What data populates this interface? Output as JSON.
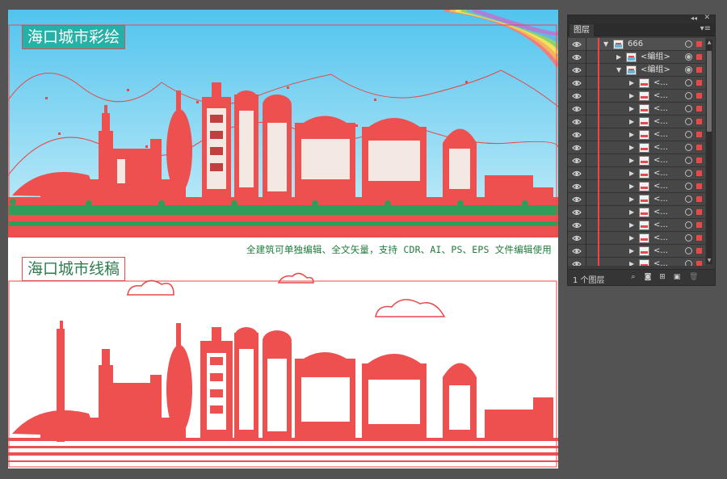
{
  "artboard": {
    "title_color": "海口城市彩绘",
    "title_line": "海口城市线稿",
    "tagline": "全建筑可单独编辑、全文矢量，支持 CDR、AI、PS、EPS 文件编辑使用"
  },
  "colors": {
    "accent_red": "#e84848",
    "sky_top": "#52c4ee",
    "sky_bottom": "#c9eef9",
    "teal_title": "#26b1a8",
    "green_ground": "#2e9e5a",
    "panel_bg": "#3c3c3c",
    "workspace": "#535353"
  },
  "layers_panel": {
    "tab_label": "图层",
    "footer_count": "1 个图层",
    "rows": [
      {
        "label": "666",
        "level": 0,
        "expanded": true,
        "thumb": "group",
        "targeted": false
      },
      {
        "label": "<编组>",
        "level": 1,
        "expanded": false,
        "thumb": "group",
        "targeted": true
      },
      {
        "label": "<编组>",
        "level": 1,
        "expanded": true,
        "thumb": "group",
        "targeted": true
      },
      {
        "label": "<...",
        "level": 2,
        "expanded": false,
        "thumb": "item",
        "targeted": false
      },
      {
        "label": "<...",
        "level": 2,
        "expanded": false,
        "thumb": "item",
        "targeted": false
      },
      {
        "label": "<...",
        "level": 2,
        "expanded": false,
        "thumb": "item",
        "targeted": false
      },
      {
        "label": "<...",
        "level": 2,
        "expanded": false,
        "thumb": "item",
        "targeted": false
      },
      {
        "label": "<...",
        "level": 2,
        "expanded": false,
        "thumb": "item",
        "targeted": false
      },
      {
        "label": "<...",
        "level": 2,
        "expanded": false,
        "thumb": "item",
        "targeted": false
      },
      {
        "label": "<...",
        "level": 2,
        "expanded": false,
        "thumb": "item",
        "targeted": false
      },
      {
        "label": "<...",
        "level": 2,
        "expanded": false,
        "thumb": "item",
        "targeted": false
      },
      {
        "label": "<...",
        "level": 2,
        "expanded": false,
        "thumb": "item",
        "targeted": false
      },
      {
        "label": "<...",
        "level": 2,
        "expanded": false,
        "thumb": "item",
        "targeted": false
      },
      {
        "label": "<...",
        "level": 2,
        "expanded": false,
        "thumb": "item",
        "targeted": false
      },
      {
        "label": "<...",
        "level": 2,
        "expanded": false,
        "thumb": "item",
        "targeted": false
      },
      {
        "label": "<...",
        "level": 2,
        "expanded": false,
        "thumb": "item",
        "targeted": false
      },
      {
        "label": "<...",
        "level": 2,
        "expanded": false,
        "thumb": "item",
        "targeted": false
      },
      {
        "label": "<...",
        "level": 2,
        "expanded": false,
        "thumb": "item",
        "targeted": false
      }
    ],
    "footer_icons": [
      "locate-object-icon",
      "make-clipping-mask-icon",
      "create-sublayer-icon",
      "create-new-layer-icon",
      "delete-layer-icon"
    ]
  }
}
